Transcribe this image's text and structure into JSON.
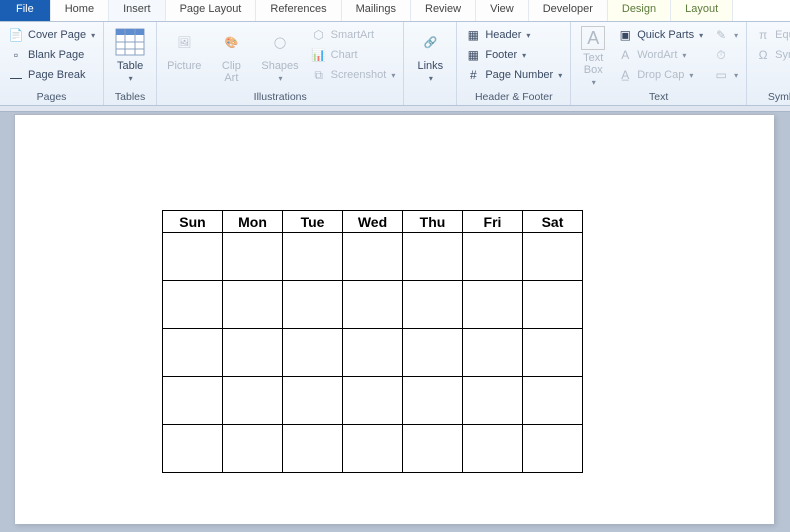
{
  "tabs": {
    "file": "File",
    "home": "Home",
    "insert": "Insert",
    "pageLayout": "Page Layout",
    "references": "References",
    "mailings": "Mailings",
    "review": "Review",
    "view": "View",
    "developer": "Developer",
    "design": "Design",
    "layout": "Layout"
  },
  "groups": {
    "pages": {
      "label": "Pages",
      "coverPage": "Cover Page",
      "blankPage": "Blank Page",
      "pageBreak": "Page Break"
    },
    "tables": {
      "label": "Tables",
      "table": "Table"
    },
    "illustrations": {
      "label": "Illustrations",
      "picture": "Picture",
      "clipArt": "Clip\nArt",
      "shapes": "Shapes",
      "smartArt": "SmartArt",
      "chart": "Chart",
      "screenshot": "Screenshot"
    },
    "links": {
      "label": " ",
      "links": "Links"
    },
    "headerFooter": {
      "label": "Header & Footer",
      "header": "Header",
      "footer": "Footer",
      "pageNumber": "Page Number"
    },
    "text": {
      "label": "Text",
      "textBox": "Text\nBox",
      "quickParts": "Quick Parts",
      "wordArt": "WordArt",
      "dropCap": "Drop Cap"
    },
    "symbols": {
      "label": "Symbols",
      "equation": "Equation",
      "symbol": "Symbol"
    }
  },
  "calendar": {
    "headers": [
      "Sun",
      "Mon",
      "Tue",
      "Wed",
      "Thu",
      "Fri",
      "Sat"
    ]
  }
}
